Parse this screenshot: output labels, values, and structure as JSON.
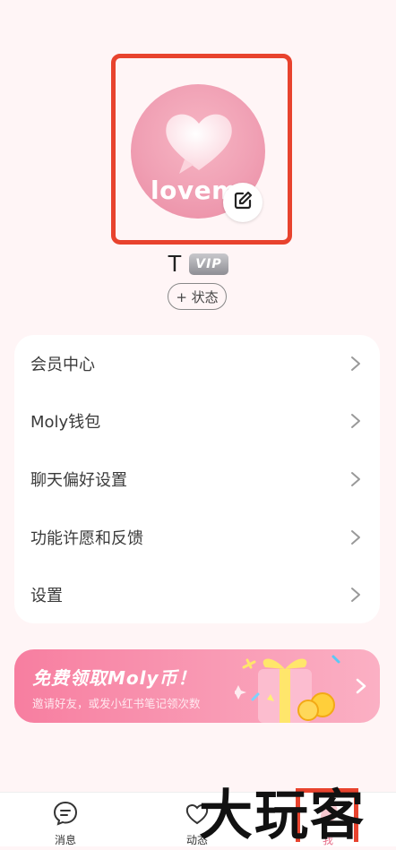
{
  "profile": {
    "avatar_text": "lovem",
    "username": "T",
    "vip_label": "VIP",
    "status_label": "+ 状态"
  },
  "menu": {
    "items": [
      {
        "label": "会员中心"
      },
      {
        "label": "Moly钱包"
      },
      {
        "label": "聊天偏好设置"
      },
      {
        "label": "功能许愿和反馈"
      },
      {
        "label": "设置"
      }
    ]
  },
  "banner": {
    "title": "免费领取Moly币！",
    "subtitle": "邀请好友，或发小红书笔记领次数"
  },
  "nav": {
    "messages_label": "消息",
    "moments_label": "动态",
    "me_label": "我"
  },
  "overlay": {
    "watermark": "大玩客"
  },
  "colors": {
    "highlight": "#e8432e",
    "avatar_pink": "#f0a0b4",
    "banner_pink": "#f77ea0",
    "background": "#fff5f6"
  }
}
